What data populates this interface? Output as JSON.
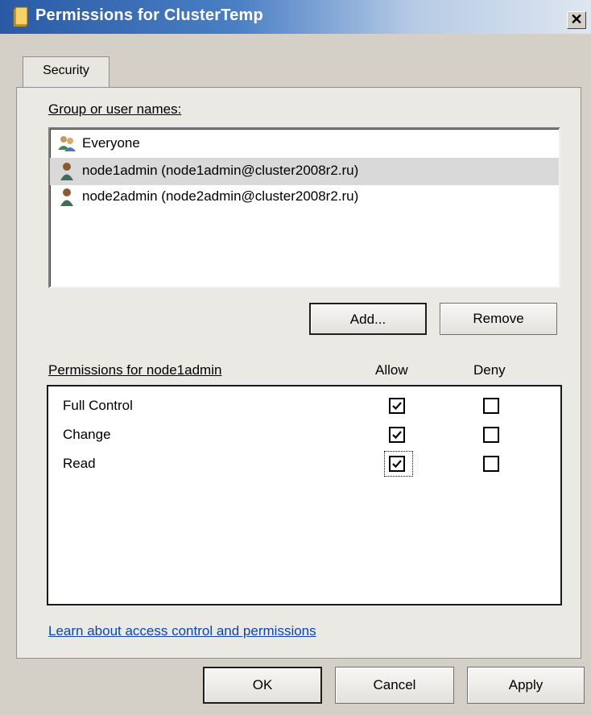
{
  "window": {
    "title": "Permissions for ClusterTemp",
    "close_label": "✕"
  },
  "tabs": [
    {
      "label": "Security",
      "selected": true
    }
  ],
  "group_list": {
    "label": "Group or user names:",
    "items": [
      {
        "name": "Everyone",
        "icon": "group-icon",
        "selected": false
      },
      {
        "name": "node1admin (node1admin@cluster2008r2.ru)",
        "icon": "user-icon",
        "selected": true
      },
      {
        "name": "node2admin (node2admin@cluster2008r2.ru)",
        "icon": "user-icon",
        "selected": false
      }
    ]
  },
  "list_buttons": {
    "add": "Add...",
    "remove": "Remove"
  },
  "permissions": {
    "label": "Permissions for node1admin",
    "columns": [
      "Allow",
      "Deny"
    ],
    "rows": [
      {
        "name": "Full Control",
        "allow": true,
        "deny": false
      },
      {
        "name": "Change",
        "allow": true,
        "deny": false
      },
      {
        "name": "Read",
        "allow": true,
        "deny": false,
        "focused": true
      }
    ]
  },
  "help_link": "Learn about access control and permissions",
  "footer_buttons": {
    "ok": "OK",
    "cancel": "Cancel",
    "apply": "Apply"
  },
  "colors": {
    "title_bar_start": "#2a5aa6",
    "dialog_bg": "#d4d0c8",
    "link": "#0d46a8",
    "selected_row": "#d9d9d9"
  }
}
